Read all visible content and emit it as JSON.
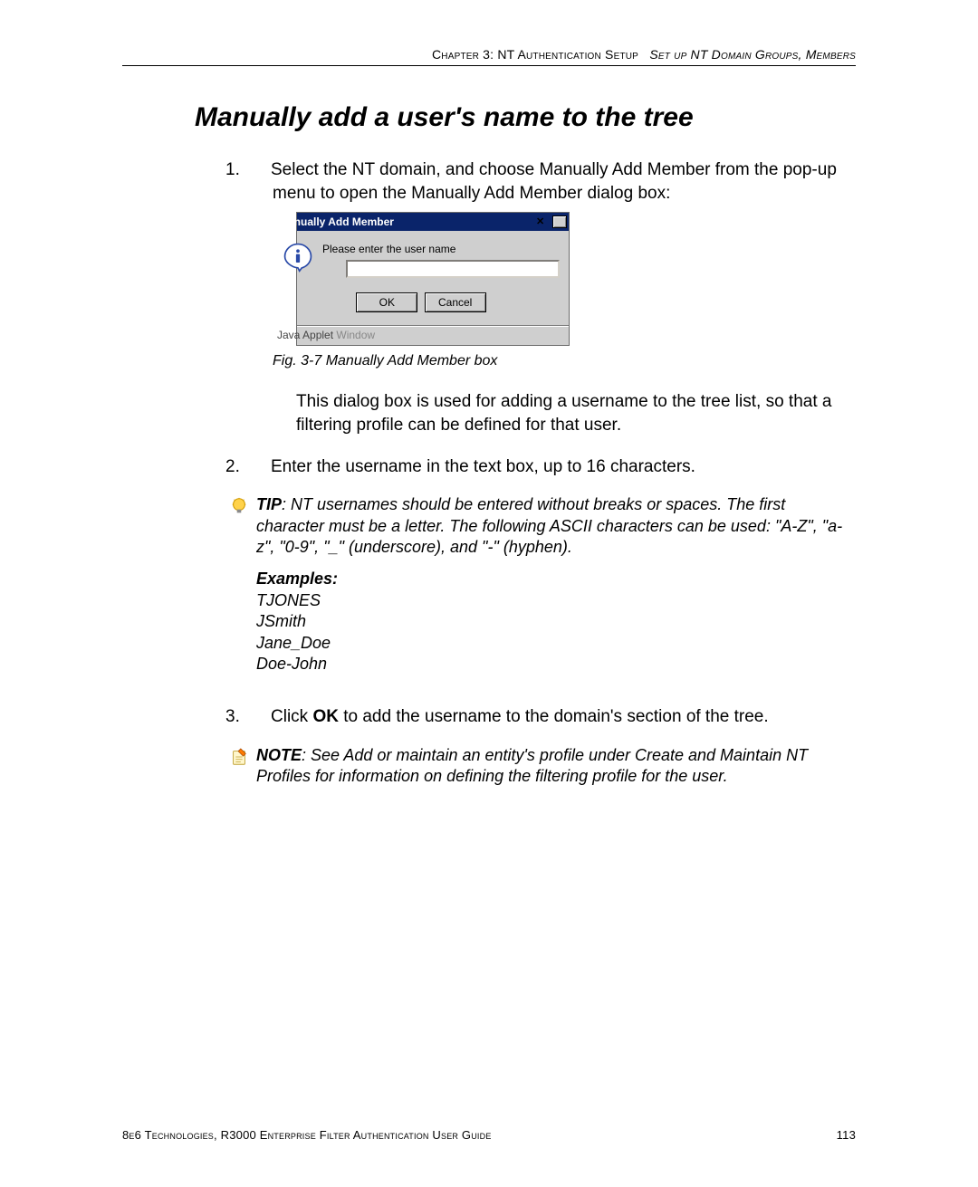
{
  "header": {
    "chapter": "Chapter 3: NT Authentication Setup",
    "subtitle": "Set up NT Domain Groups, Members"
  },
  "section_title": "Manually add a user's name to the tree",
  "steps": {
    "s1_num": "1.",
    "s1_text": "Select the NT domain, and choose Manually Add Member from the pop-up menu to open the Manually Add Member dialog box:",
    "s2_num": "2.",
    "s2_text": "Enter the username in the text box, up to 16 characters.",
    "s3_num": "3.",
    "s3_pre": "Click ",
    "s3_bold": "OK",
    "s3_post": " to add the username to the domain's section of the tree."
  },
  "dialog": {
    "title": "Manually Add Member",
    "close_glyph": "✕",
    "prompt": "Please enter the user name",
    "input_value": "",
    "ok": "OK",
    "cancel": "Cancel",
    "status_pre": "Java Applet ",
    "status_post": "Window"
  },
  "fig_caption": "Fig. 3-7  Manually Add Member box",
  "explain": "This dialog box is used for adding a username to the tree list, so that a filtering profile can be defined for that user.",
  "tip": {
    "label": "TIP",
    "text": ": NT usernames should be entered without breaks or spaces. The first character must be a letter. The following ASCII characters can be used: \"A-Z\", \"a-z\", \"0-9\", \"_\" (underscore), and \"-\" (hyphen)."
  },
  "examples": {
    "label": "Examples:",
    "items": [
      "TJONES",
      "JSmith",
      "Jane_Doe",
      "Doe-John"
    ]
  },
  "note": {
    "label": "NOTE",
    "text": ": See Add or maintain an entity's profile under Create and Maintain NT Profiles for information on defining the filtering profile for the user."
  },
  "footer": {
    "left": "8e6 Technologies, R3000 Enterprise Filter Authentication User Guide",
    "right": "113"
  }
}
